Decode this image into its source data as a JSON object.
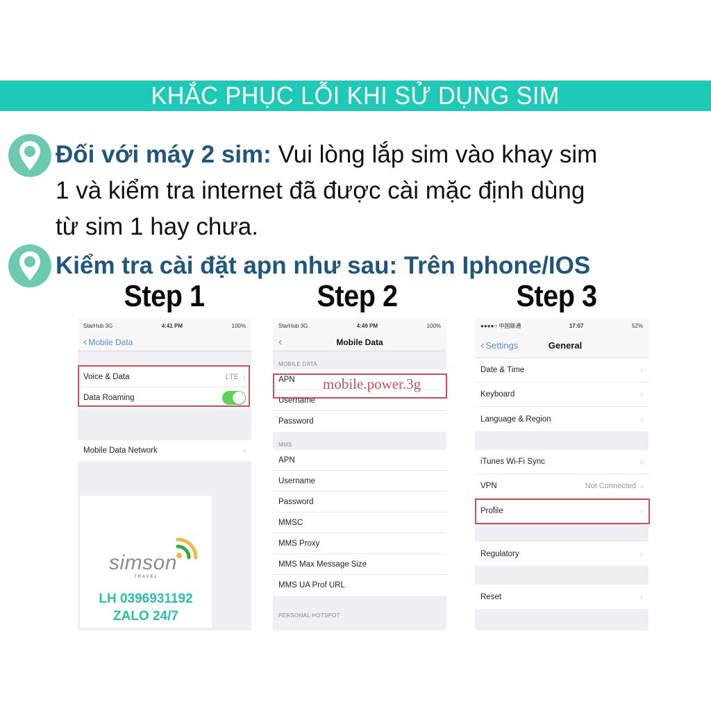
{
  "banner": {
    "title": "KHẮC PHỤC LỖI KHI SỬ DỤNG SIM"
  },
  "bullets": [
    {
      "icon": "location-pin-icon",
      "heading": "Đối với máy 2 sim:",
      "line1_rest": " Vui lòng lắp sim vào khay sim",
      "line2": "1 và kiểm tra internet đã được cài mặc định dùng",
      "line3": "từ sim 1 hay chưa."
    },
    {
      "icon": "location-pin-icon",
      "heading": "Kiểm tra cài đặt apn như sau: Trên Iphone/IOS"
    }
  ],
  "steps": [
    {
      "title": "Step 1",
      "status": {
        "carrier": "StarHub 3G",
        "time": "4:41 PM",
        "battery": "100%"
      },
      "nav": {
        "back": "Mobile Data",
        "title": ""
      },
      "rows": [
        {
          "label": "Voice & Data",
          "value": "LTE"
        },
        {
          "label": "Data Roaming",
          "toggle": true
        }
      ],
      "rows2": [
        {
          "label": "Mobile Data Network"
        }
      ]
    },
    {
      "title": "Step 2",
      "status": {
        "carrier": "StarHub 3G",
        "time": "4:49 PM",
        "battery": "100%"
      },
      "nav": {
        "back": "",
        "title": "Mobile Data"
      },
      "section1": "MOBILE DATA",
      "rows": [
        {
          "label": "APN"
        },
        {
          "label": "Username"
        },
        {
          "label": "Password"
        }
      ],
      "apn_value": "mobile.power.3g",
      "section2": "MMS",
      "rows2": [
        {
          "label": "APN"
        },
        {
          "label": "Username"
        },
        {
          "label": "Password"
        },
        {
          "label": "MMSC"
        },
        {
          "label": "MMS Proxy"
        },
        {
          "label": "MMS Max Message Size"
        },
        {
          "label": "MMS UA Prof URL"
        }
      ],
      "section3": "PERSONAL HOTSPOT"
    },
    {
      "title": "Step 3",
      "status": {
        "carrier": "●●●●○ 中国联通",
        "time": "17:07",
        "battery": "52%"
      },
      "nav": {
        "back": "Settings",
        "title": "General"
      },
      "rows": [
        {
          "label": "Date & Time"
        },
        {
          "label": "Keyboard"
        },
        {
          "label": "Language & Region"
        }
      ],
      "rows2": [
        {
          "label": "iTunes Wi-Fi Sync"
        },
        {
          "label": "VPN",
          "value": "Not Connected"
        },
        {
          "label": "Profile"
        }
      ],
      "rows3": [
        {
          "label": "Regulatory"
        }
      ],
      "rows4": [
        {
          "label": "Reset"
        }
      ]
    }
  ],
  "logo": {
    "brand": "simson",
    "tagline": "TRAVEL",
    "contact_line1": "LH 0396931192",
    "contact_line2": "ZALO 24/7"
  },
  "colors": {
    "banner": "#1ec9b7",
    "heading": "#20567a",
    "pin": "#6dcab1",
    "highlight_box": "#c8505c",
    "contact": "#27c0a8"
  }
}
